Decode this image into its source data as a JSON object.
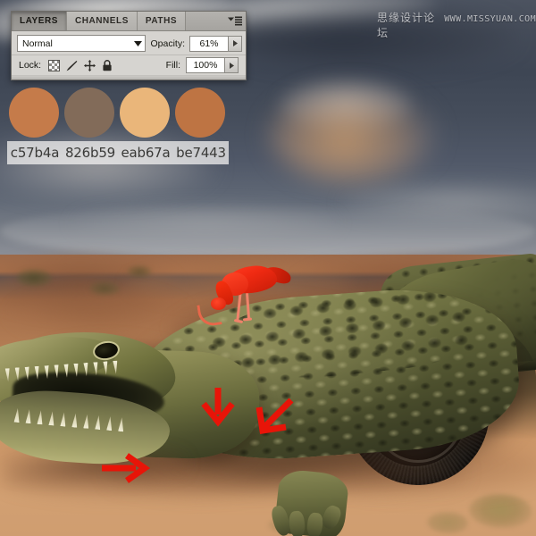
{
  "panel": {
    "tabs": [
      {
        "label": "LAYERS",
        "active": true
      },
      {
        "label": "CHANNELS",
        "active": false
      },
      {
        "label": "PATHS",
        "active": false
      }
    ],
    "menu_icon": "panel-menu-icon",
    "blend_mode": {
      "value": "Normal",
      "dropdown_icon": "chevron-down-icon"
    },
    "opacity": {
      "label": "Opacity:",
      "value": "61%",
      "stepper_icon": "triangle-right-icon"
    },
    "fill": {
      "label": "Fill:",
      "value": "100%",
      "stepper_icon": "triangle-right-icon"
    },
    "lock": {
      "label": "Lock:",
      "icons": [
        {
          "name": "lock-transparency-icon",
          "title": "Lock transparent pixels"
        },
        {
          "name": "lock-image-brush-icon",
          "title": "Lock image pixels"
        },
        {
          "name": "lock-position-move-icon",
          "title": "Lock position"
        },
        {
          "name": "lock-all-padlock-icon",
          "title": "Lock all"
        }
      ]
    }
  },
  "swatches": [
    {
      "hex": "#c57b4a",
      "label": "c57b4a"
    },
    {
      "hex": "#826b59",
      "label": "826b59"
    },
    {
      "hex": "#eab67a",
      "label": "eab67a"
    },
    {
      "hex": "#be7443",
      "label": "be7443"
    }
  ],
  "watermark": {
    "chinese": "思缘设计论坛",
    "url": "WWW.MISSYUAN.COM"
  },
  "photo": {
    "description": "Desert photo composite of a crocodile with a vintage car wheel",
    "annotation_color": "#e81408",
    "arrows": [
      {
        "name": "annotation-arrow-down",
        "direction": "down"
      },
      {
        "name": "annotation-arrow-diagonal",
        "direction": "down-left"
      },
      {
        "name": "annotation-arrow-right",
        "direction": "right"
      }
    ],
    "subjects": [
      {
        "name": "crocodile",
        "label": "crocodile"
      },
      {
        "name": "scarlet-ibis-bird",
        "label": "scarlet ibis"
      },
      {
        "name": "car-wheel",
        "label": "vintage car wheel"
      }
    ]
  }
}
